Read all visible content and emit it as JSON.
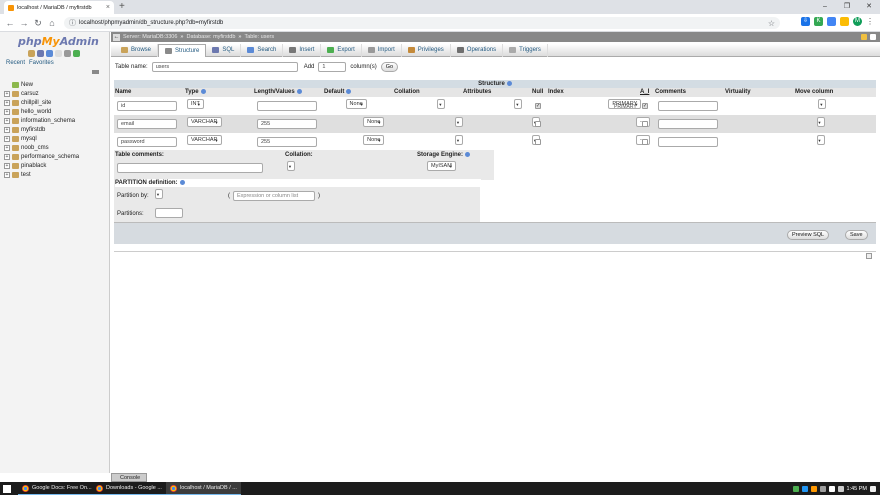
{
  "browser": {
    "tab_title": "localhost / MariaDB / myfirstdb",
    "tab_close": "×",
    "new_tab": "+",
    "window_controls": [
      "–",
      "❐",
      "✕"
    ],
    "url": "localhost/phpmyadmin/db_structure.php?db=myfirstdb",
    "back": "←",
    "forward": "→",
    "reload": "↻",
    "home": "⌂",
    "avatar_letter": "M",
    "menu": "⋮"
  },
  "nav": {
    "logo_php": "php",
    "logo_my": "My",
    "logo_admin": "Admin",
    "recent": "Recent",
    "favorites": "Favorites",
    "databases": [
      "New",
      "carsuz",
      "chillpill_site",
      "hello_world",
      "information_schema",
      "myfirstdb",
      "mysql",
      "noob_cms",
      "performance_schema",
      "pinablack",
      "test"
    ]
  },
  "breadcrumb": {
    "server": "Server: MariaDB:3306",
    "database": "Database: myfirstdb",
    "table": "Table: users",
    "sep": "»"
  },
  "tabs": [
    "Browse",
    "Structure",
    "SQL",
    "Search",
    "Insert",
    "Export",
    "Import",
    "Privileges",
    "Operations",
    "Triggers"
  ],
  "tabs_active_index": 1,
  "form": {
    "table_name_label": "Table name:",
    "table_name_value": "users",
    "add_label": "Add",
    "add_value": "1",
    "columns_label": "column(s)",
    "go_label": "Go",
    "structure_title": "Structure"
  },
  "col_headers": {
    "name": "Name",
    "type": "Type",
    "length": "Length/Values",
    "default": "Default",
    "collation": "Collation",
    "attributes": "Attributes",
    "null": "Null",
    "index": "Index",
    "ai": "A_I",
    "comments": "Comments",
    "virtuality": "Virtuality",
    "move": "Move column"
  },
  "fields": [
    {
      "name": "id",
      "type": "INT",
      "length": "",
      "default": "None",
      "index": "PRIMARY",
      "index_badge": "PRIMARY",
      "null_checked": true,
      "ai_checked": true
    },
    {
      "name": "email",
      "type": "VARCHAR",
      "length": "255",
      "default": "None",
      "index": "---",
      "index_badge": "",
      "null_checked": false,
      "ai_checked": false
    },
    {
      "name": "password",
      "type": "VARCHAR",
      "length": "255",
      "default": "None",
      "index": "---",
      "index_badge": "",
      "null_checked": false,
      "ai_checked": false
    }
  ],
  "table_opts": {
    "comments_label": "Table comments:",
    "collation_label": "Collation:",
    "engine_label": "Storage Engine:",
    "engine_value": "MyISAM"
  },
  "partition": {
    "title": "PARTITION definition:",
    "by_label": "Partition by:",
    "expr_placeholder": "Expression or column list",
    "paren_open": "(",
    "paren_close": ")",
    "partitions_label": "Partitions:"
  },
  "actions": {
    "preview_sql": "Preview SQL",
    "save": "Save"
  },
  "console_label": "Console",
  "taskbar": {
    "apps": [
      "Google Docs: Free On...",
      "Downloads - Google ...",
      "localhost / MariaDB / ..."
    ],
    "time": "1:45 PM"
  }
}
